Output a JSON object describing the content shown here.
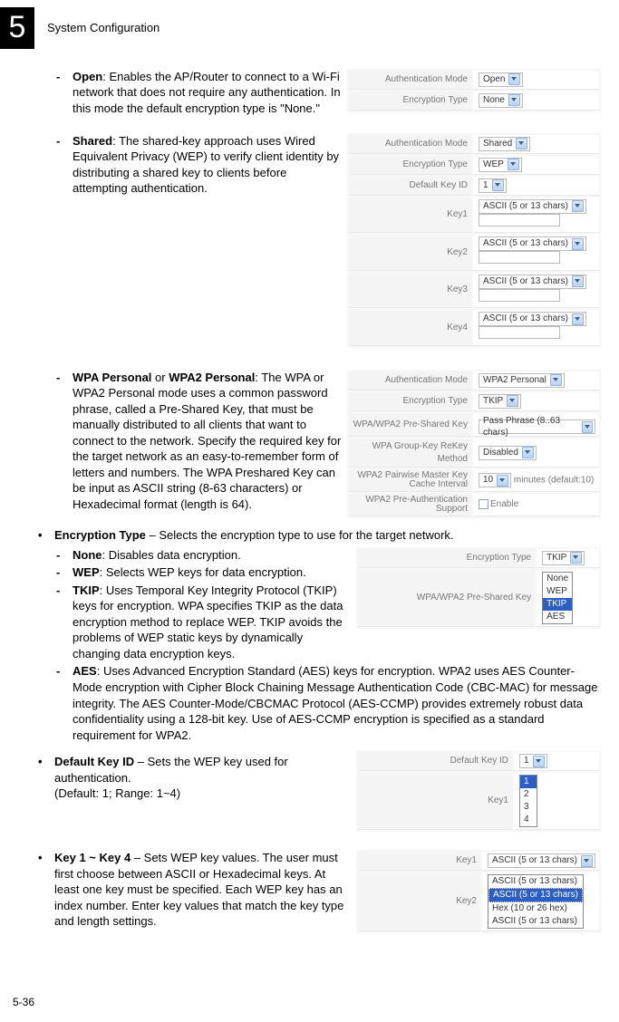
{
  "chapter": {
    "number": "5",
    "title": "System Configuration"
  },
  "pageNumber": "5-36",
  "items": {
    "open": {
      "head": "Open",
      "body": ": Enables the AP/Router to connect to a Wi-Fi network that does not require any authentication. In this mode the default encryption type is \"None.\""
    },
    "shared": {
      "head": "Shared",
      "body": ": The shared-key approach uses Wired Equivalent Privacy (WEP) to verify client identity by distributing a shared key to clients before attempting authentication."
    },
    "wpa": {
      "head1": "WPA Personal",
      "mid": " or ",
      "head2": "WPA2 Personal",
      "body": ": The WPA or WPA2 Personal mode uses a common password phrase, called a Pre-Shared Key, that must be manually distributed to all clients that want to connect to the network. Specify the required key for the target network as an easy-to-remember form of letters and numbers. The WPA Preshared Key can be input as ASCII string (8-63 characters) or Hexadecimal format (length is 64)."
    },
    "encType": {
      "head": "Encryption Type",
      "body": " – Selects the encryption type to use for the target network."
    },
    "none": {
      "head": "None",
      "body": ": Disables data encryption."
    },
    "wep": {
      "head": "WEP",
      "body": ": Selects WEP keys for data encryption."
    },
    "tkip": {
      "head": "TKIP",
      "body": ": Uses Temporal Key Integrity Protocol (TKIP) keys for encryption. WPA specifies TKIP as the data encryption method to replace WEP. TKIP avoids the problems of WEP static keys by dynamically changing data encryption keys."
    },
    "aes": {
      "head": "AES",
      "body": ": Uses Advanced Encryption Standard (AES) keys for encryption. WPA2 uses AES Counter-Mode encryption with Cipher Block Chaining Message Authentication Code (CBC-MAC) for message integrity. The AES Counter-Mode/CBCMAC Protocol (AES-CCMP) provides extremely robust data confidentiality using a 128-bit key. Use of AES-CCMP encryption is specified as a standard requirement for WPA2."
    },
    "defKey": {
      "head": "Default Key ID",
      "body": " – Sets the WEP key used for authentication.",
      "note": "(Default: 1; Range: 1~4)"
    },
    "key14": {
      "head": "Key 1 ~ Key 4",
      "body": " – Sets WEP key values. The user must first choose between ASCII or Hexadecimal keys.  At least one key must be specified. Each WEP key has an index number. Enter key values that match the key type and length settings."
    }
  },
  "shots": {
    "open": {
      "rows": [
        {
          "label": "Authentication Mode",
          "val": "Open"
        },
        {
          "label": "Encryption Type",
          "val": "None"
        }
      ]
    },
    "shared": {
      "rows": [
        {
          "label": "Authentication Mode",
          "val": "Shared"
        },
        {
          "label": "Encryption Type",
          "val": "WEP"
        },
        {
          "label": "Default Key ID",
          "val": "1"
        },
        {
          "label": "Key1",
          "val": "ASCII (5 or 13 chars)"
        },
        {
          "label": "Key2",
          "val": "ASCII (5 or 13 chars)"
        },
        {
          "label": "Key3",
          "val": "ASCII (5 or 13 chars)"
        },
        {
          "label": "Key4",
          "val": "ASCII (5 or 13 chars)"
        }
      ]
    },
    "wpa": {
      "rows": [
        {
          "label": "Authentication Mode",
          "val": "WPA2 Personal"
        },
        {
          "label": "Encryption Type",
          "val": "TKIP"
        },
        {
          "label": "WPA/WPA2 Pre-Shared Key",
          "val": "Pass Phrase (8..63 chars)"
        },
        {
          "label": "WPA Group-Key ReKey Method",
          "val": "Disabled"
        },
        {
          "label": "WPA2 Pairwise Master Key Cache Interval",
          "val": "10",
          "suffix": "minutes (default:10)"
        },
        {
          "label": "WPA2 Pre-Authentication Support",
          "val": "Enable",
          "checkbox": true
        }
      ]
    },
    "encType": {
      "rows": [
        {
          "label": "Encryption Type",
          "val": "TKIP"
        },
        {
          "label": "WPA/WPA2 Pre-Shared Key",
          "val": ""
        }
      ],
      "options": [
        "None",
        "WEP",
        "TKIP",
        "AES"
      ],
      "selected": "TKIP"
    },
    "defKey": {
      "rows": [
        {
          "label": "Default Key ID",
          "val": "1"
        },
        {
          "label": "Key1",
          "val": ""
        }
      ],
      "options": [
        "1",
        "2",
        "3",
        "4"
      ],
      "selected": "1"
    },
    "key14": {
      "rows": [
        {
          "label": "Key1",
          "val": "ASCII (5 or 13 chars)"
        },
        {
          "label": "Key2",
          "val": ""
        }
      ],
      "options": [
        "ASCII (5 or 13 chars)",
        "ASCII (5 or 13 chars)",
        "Hex (10 or 26 hex)",
        "ASCII (5 or 13 chars)"
      ],
      "selected": "Hex (10 or 26 hex)"
    }
  }
}
